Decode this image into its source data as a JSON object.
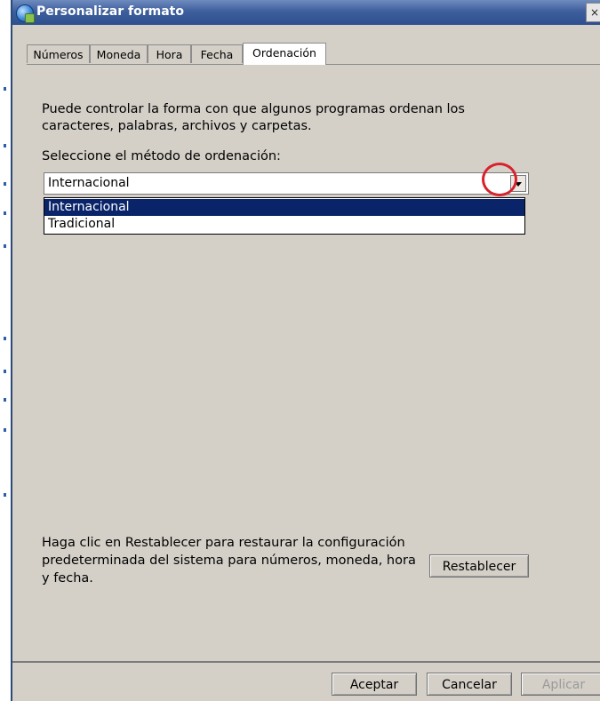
{
  "window": {
    "title": "Personalizar formato",
    "close_glyph": "×"
  },
  "tabs": [
    {
      "label": "Números"
    },
    {
      "label": "Moneda"
    },
    {
      "label": "Hora"
    },
    {
      "label": "Fecha"
    },
    {
      "label": "Ordenación"
    }
  ],
  "active_tab": "Ordenación",
  "sorting": {
    "description": "Puede controlar la forma con que algunos programas ordenan los caracteres, palabras, archivos y carpetas.",
    "method_label": "Seleccione el método de ordenación:",
    "selected_value": "Internacional",
    "options": [
      "Internacional",
      "Tradicional"
    ]
  },
  "reset": {
    "description": "Haga clic en Restablecer para restaurar la configuración predeterminada del sistema para números, moneda, hora y fecha.",
    "button_label": "Restablecer"
  },
  "footer": {
    "ok_label": "Aceptar",
    "cancel_label": "Cancelar",
    "apply_label": "Aplicar"
  },
  "colors": {
    "title_bar": "#2d4f8f",
    "selection": "#0a246a",
    "annotation": "#d8212c",
    "dialog_bg": "#d4d0c8"
  }
}
